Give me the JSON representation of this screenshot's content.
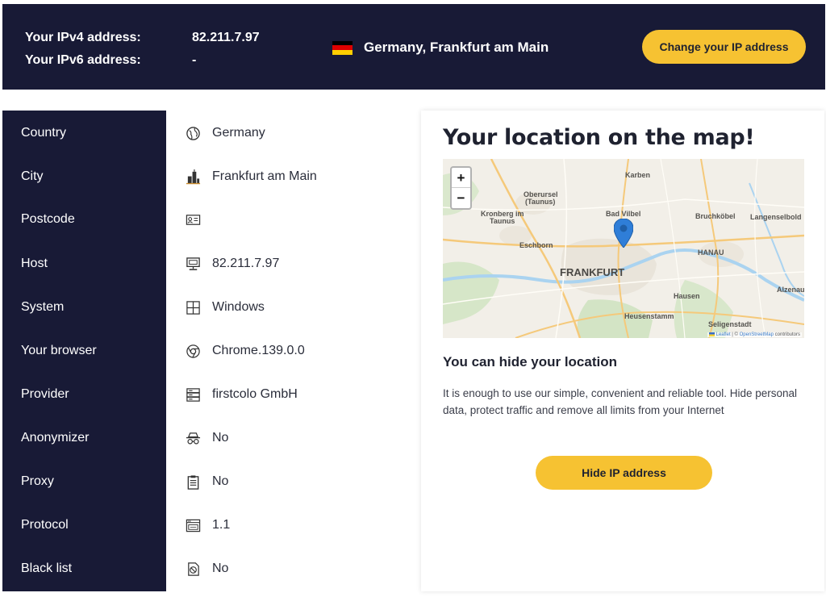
{
  "header": {
    "ipv4_label": "Your IPv4 address:",
    "ipv6_label": "Your IPv6 address:",
    "ipv4_value": "82.211.7.97",
    "ipv6_value": "-",
    "flag_icon": "germany-flag-icon",
    "location": "Germany, Frankfurt am Main",
    "change_button": "Change your IP address"
  },
  "info": {
    "rows": [
      {
        "label": "Country",
        "value": "Germany",
        "icon": "globe-icon"
      },
      {
        "label": "City",
        "value": "Frankfurt am Main",
        "icon": "city-buildings-icon"
      },
      {
        "label": "Postcode",
        "value": "",
        "icon": "postcode-card-icon"
      },
      {
        "label": "Host",
        "value": "82.211.7.97",
        "icon": "monitor-icon"
      },
      {
        "label": "System",
        "value": "Windows",
        "icon": "windows-icon"
      },
      {
        "label": "Your browser",
        "value": "Chrome.139.0.0",
        "icon": "chrome-icon"
      },
      {
        "label": "Provider",
        "value": "firstcolo GmbH",
        "icon": "server-icon"
      },
      {
        "label": "Anonymizer",
        "value": "No",
        "icon": "spy-icon"
      },
      {
        "label": "Proxy",
        "value": "No",
        "icon": "clipboard-icon"
      },
      {
        "label": "Protocol",
        "value": "1.1",
        "icon": "browser-window-icon"
      },
      {
        "label": "Black list",
        "value": "No",
        "icon": "blocked-list-icon"
      }
    ]
  },
  "map_card": {
    "title": "Your location on the map!",
    "zoom_in": "+",
    "zoom_out": "−",
    "map_labels": {
      "karben": "Karben",
      "oberursel": "Oberursel",
      "taunus1": "(Taunus)",
      "kronberg": "Kronberg im",
      "taunus2": "Taunus",
      "bad_vilbel": "Bad Vilbel",
      "bruchkobel": "Bruchköbel",
      "langenselbold": "Langenselbold",
      "eschborn": "Eschborn",
      "hanau": "HANAU",
      "frankfurt": "FRANKFURT",
      "alzenau": "Alzenau",
      "hausen": "Hausen",
      "heusenstamm": "Heusenstamm",
      "seligenstadt": "Seligenstadt"
    },
    "attribution_leaflet": "Leaflet",
    "attribution_sep": " | © ",
    "attribution_osm": "OpenStreetMap",
    "attribution_tail": " contributors",
    "hide_title": "You can hide your location",
    "hide_description": "It is enough to use our simple, convenient and reliable tool. Hide personal data, protect traffic and remove all limits from your Internet",
    "hide_button": "Hide IP address"
  },
  "colors": {
    "navy": "#181a36",
    "accent_yellow": "#f6c232",
    "map_pin": "#2f7ed8"
  }
}
